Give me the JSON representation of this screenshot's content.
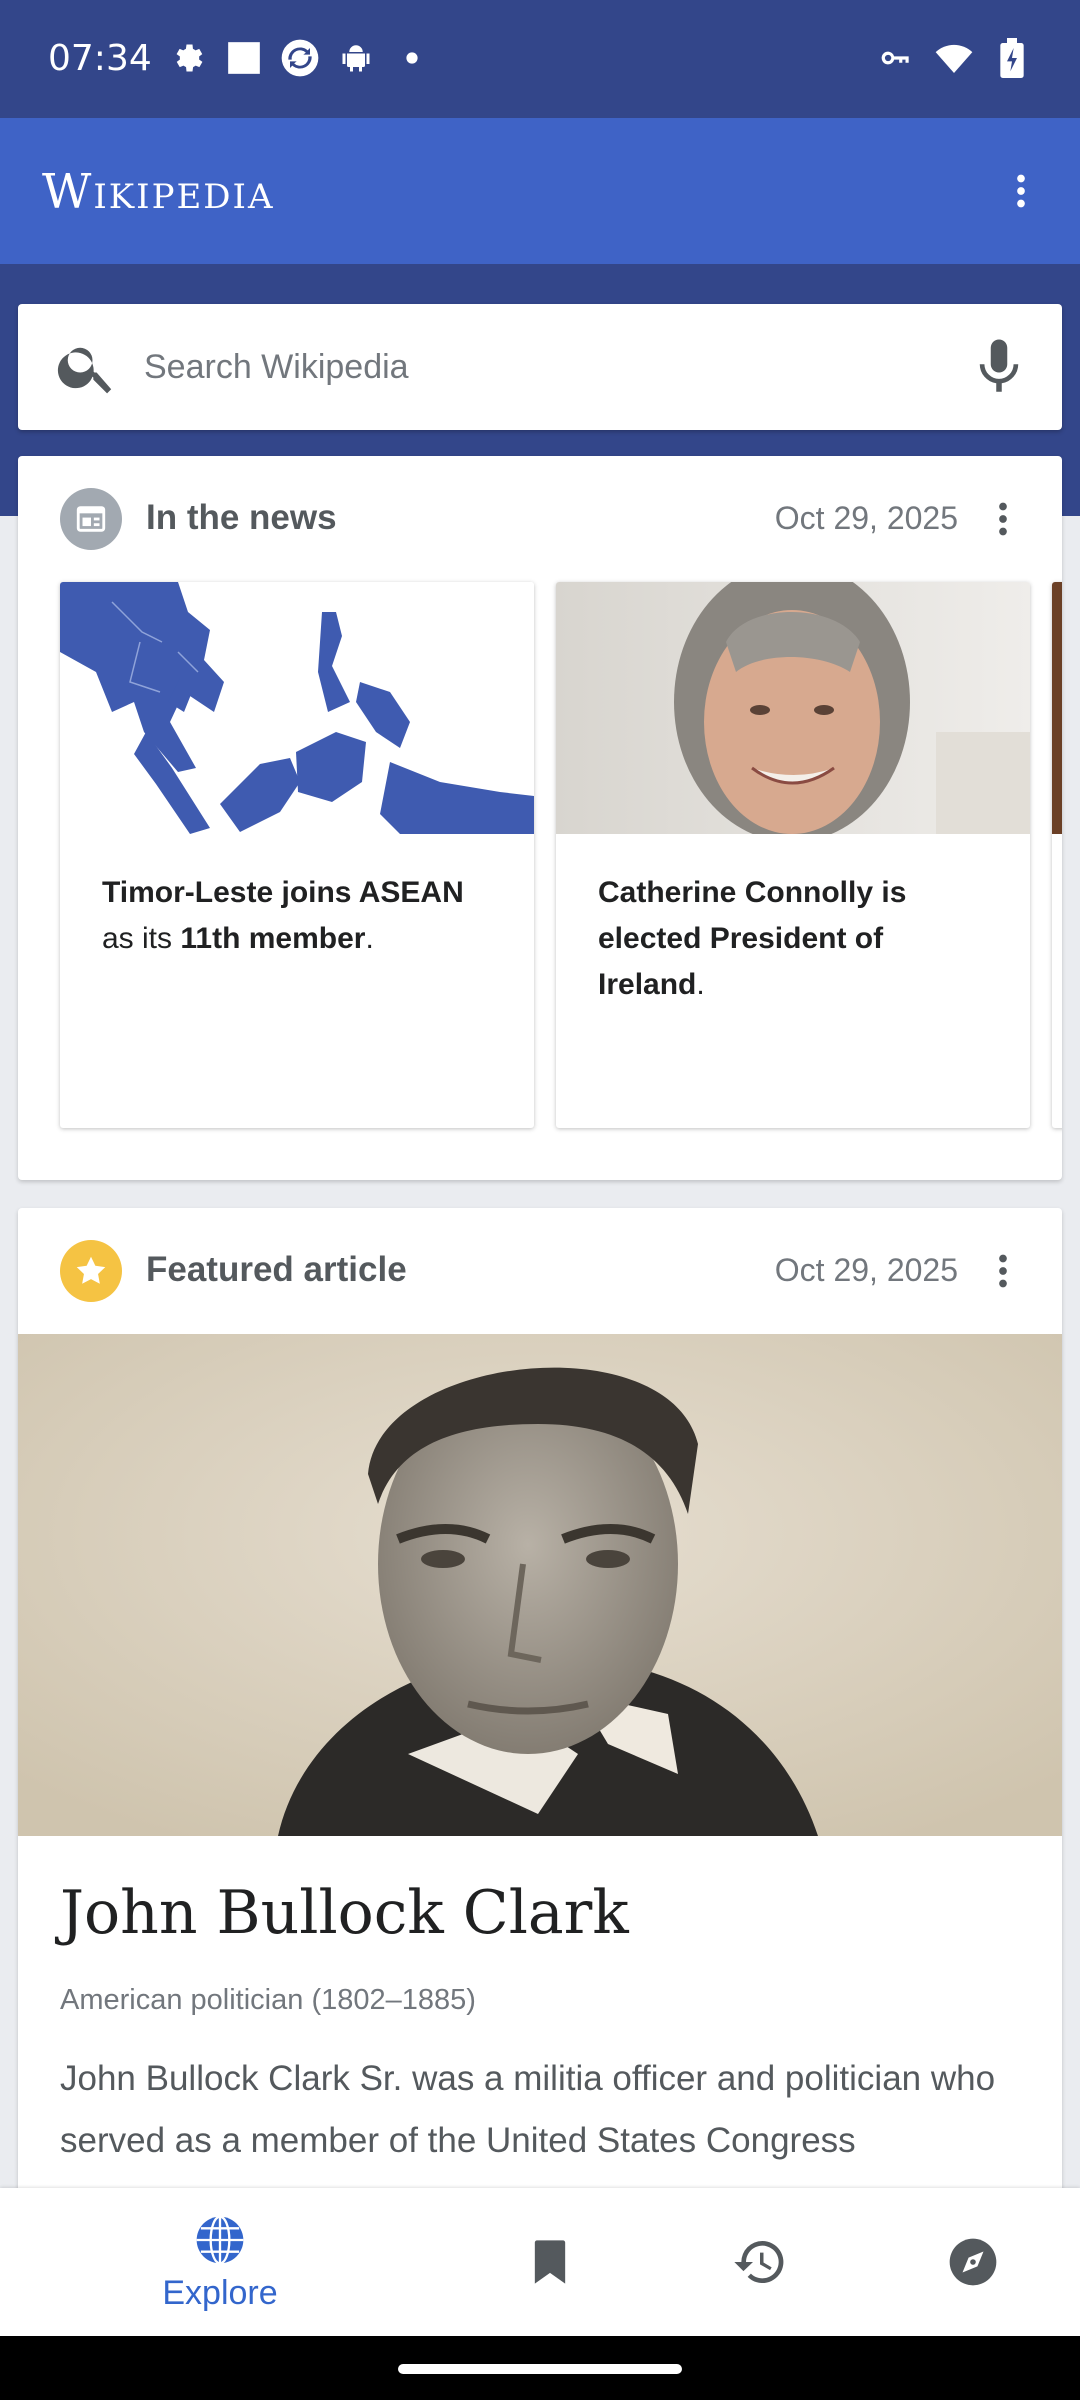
{
  "status_bar": {
    "time": "07:34",
    "left_icons": [
      "settings-gear-icon",
      "square-notification-icon",
      "sync-app-icon",
      "android-icon",
      "dot-icon"
    ],
    "right_icons": [
      "vpn-key-icon",
      "wifi-icon",
      "battery-charging-icon"
    ]
  },
  "app_bar": {
    "wordmark": "Wikipedia",
    "menu_icon": "more-vertical-icon"
  },
  "search": {
    "placeholder": "Search Wikipedia",
    "value": ""
  },
  "in_the_news": {
    "title": "In the news",
    "date": "Oct 29, 2025",
    "items": [
      {
        "bold": "Timor-Leste joins ASEAN",
        "mid": " as its ",
        "bold2": "11th member",
        "end": "."
      },
      {
        "bold": "Catherine Connolly is elected President of Ireland",
        "end": "."
      }
    ]
  },
  "featured": {
    "header": "Featured article",
    "date": "Oct 29, 2025",
    "title": "John Bullock Clark",
    "description": "American politician (1802–1885)",
    "extract": "John Bullock Clark Sr. was a militia officer and politician who served as a member of the United States Congress"
  },
  "bottom_nav": {
    "explore_label": "Explore",
    "active": "explore"
  },
  "colors": {
    "status_bar": "#33468a",
    "app_bar": "#3f63c6",
    "accent": "#3366cc",
    "featured_star": "#f5c343"
  }
}
